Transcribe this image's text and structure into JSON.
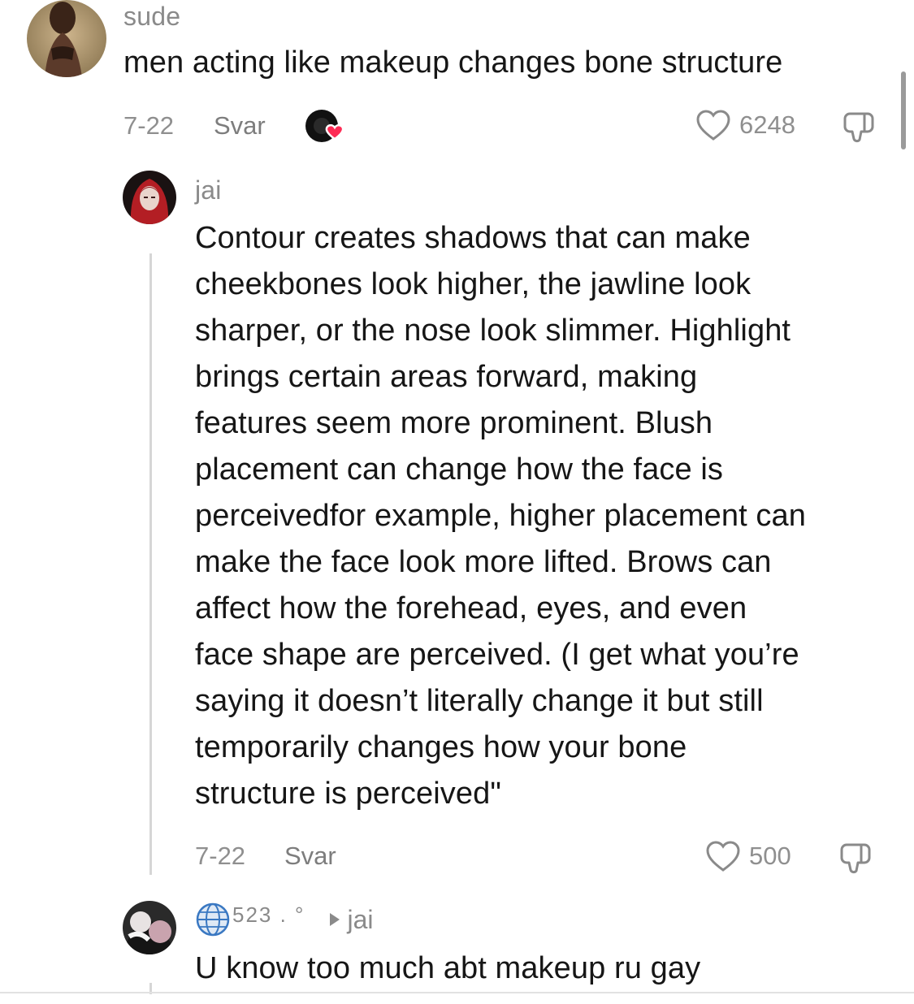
{
  "comments": [
    {
      "username": "sude",
      "text": "men acting like makeup changes bone structure",
      "date": "7-22",
      "reply_label": "Svar",
      "likes": "6248"
    },
    {
      "username": "jai",
      "text_lines": [
        "Contour creates shadows that can make",
        "cheekbones look higher, the jawline look",
        "sharper, or the nose look slimmer. Highlight",
        "brings certain areas forward, making",
        "features seem more prominent. Blush",
        "placement can change how the face is",
        "perceivedfor example, higher placement can",
        "make the face look more lifted. Brows can",
        "affect how the forehead, eyes, and even",
        "face shape are perceived. (I get what you’re",
        "saying it doesn’t literally change it but still",
        "temporarily changes how your bone",
        "structure is perceived\""
      ],
      "date": "7-22",
      "reply_label": "Svar",
      "likes": "500"
    },
    {
      "username": "523 . °",
      "reply_to": "jai",
      "text": "U know too much abt makeup ru gay"
    }
  ],
  "icons": {
    "creator_liked": "creator-liked-avatar-icon",
    "like": "heart-outline-icon",
    "dislike": "thumbs-down-outline-icon",
    "globe": "globe-icon",
    "reply_arrow": "play-triangle-icon"
  },
  "colors": {
    "text_primary": "#161616",
    "text_secondary": "#8f8f8f",
    "heart_badge": "#fe2c55"
  }
}
